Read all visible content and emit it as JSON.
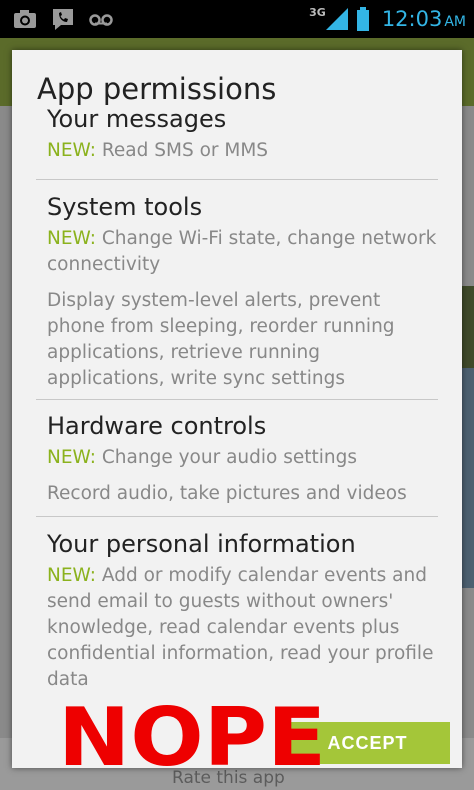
{
  "status_bar": {
    "network_type": "3G",
    "time": "12:03",
    "ampm": "AM",
    "icons": [
      "camera-icon",
      "missed-call-icon",
      "voicemail-icon",
      "signal-icon",
      "battery-icon"
    ],
    "accent_color": "#33b5e5"
  },
  "background_app": {
    "bottom_link": "Rate this app"
  },
  "dialog": {
    "title": "App permissions",
    "new_label": "NEW:",
    "new_color": "#8bb21d",
    "groups": [
      {
        "title": "Your messages",
        "new_items": "Read SMS or MMS",
        "existing_items": ""
      },
      {
        "title": "System tools",
        "new_items": "Change Wi-Fi state, change network connectivity",
        "existing_items": "Display system-level alerts, prevent phone from sleeping, reorder running applications, retrieve running applications, write sync settings"
      },
      {
        "title": "Hardware controls",
        "new_items": "Change your audio settings",
        "existing_items": "Record audio, take pictures and videos"
      },
      {
        "title": "Your personal information",
        "new_items": "Add or modify calendar events and send email to guests without owners' knowledge, read calendar events plus confidential information, read your profile data",
        "existing_items": ""
      }
    ],
    "accept_label": "ACCEPT",
    "accept_color": "#a4c639"
  },
  "overlay": {
    "stamp_text": "NOPE",
    "stamp_color": "#ee0000"
  }
}
